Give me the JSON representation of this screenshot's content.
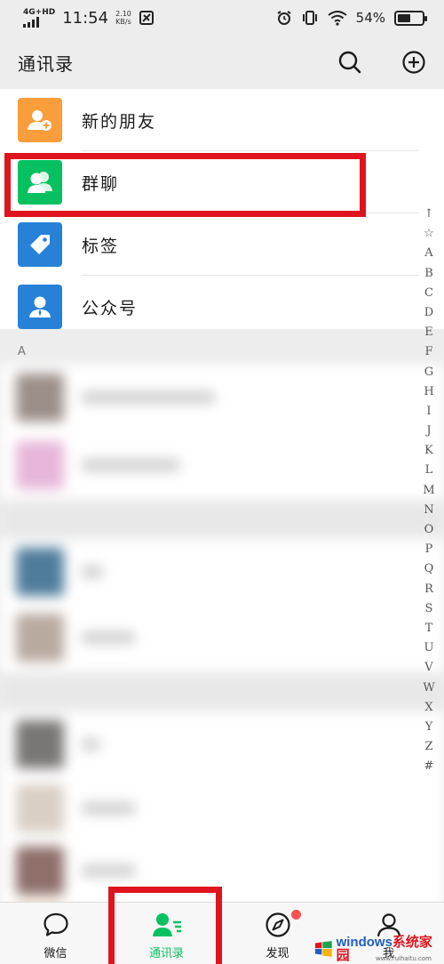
{
  "status_bar": {
    "network": "4G+HD",
    "time": "11:54",
    "speed_value": "2.10",
    "speed_unit": "KB/s",
    "battery": "54%",
    "battery_level": 0.54
  },
  "header": {
    "title": "通讯录",
    "icons": [
      "search-icon",
      "add-circle-icon"
    ]
  },
  "special_items": [
    {
      "label": "新的朋友",
      "icon": "add-friend-icon",
      "color": "#fa9d3b"
    },
    {
      "label": "群聊",
      "icon": "group-chat-icon",
      "color": "#07c160"
    },
    {
      "label": "标签",
      "icon": "tag-icon",
      "color": "#2782d7"
    },
    {
      "label": "公众号",
      "icon": "official-account-icon",
      "color": "#2782d7"
    }
  ],
  "section_header": "A",
  "alphabet_index": [
    "↑",
    "☆",
    "A",
    "B",
    "C",
    "D",
    "E",
    "F",
    "G",
    "H",
    "I",
    "J",
    "K",
    "L",
    "M",
    "N",
    "O",
    "P",
    "Q",
    "R",
    "S",
    "T",
    "U",
    "V",
    "W",
    "X",
    "Y",
    "Z",
    "#"
  ],
  "tabs": [
    {
      "label": "微信",
      "icon": "chat-bubble-icon",
      "active": false
    },
    {
      "label": "通讯录",
      "icon": "contacts-icon",
      "active": true
    },
    {
      "label": "发现",
      "icon": "compass-icon",
      "active": false,
      "badge": true
    },
    {
      "label": "我",
      "icon": "person-icon",
      "active": false
    }
  ],
  "accent_colors": {
    "green": "#07c160",
    "highlight_red": "#e0141e"
  },
  "watermark": {
    "brand": "windows",
    "brand_suffix": "系统家园",
    "url": "www.ruihaitu.com"
  }
}
